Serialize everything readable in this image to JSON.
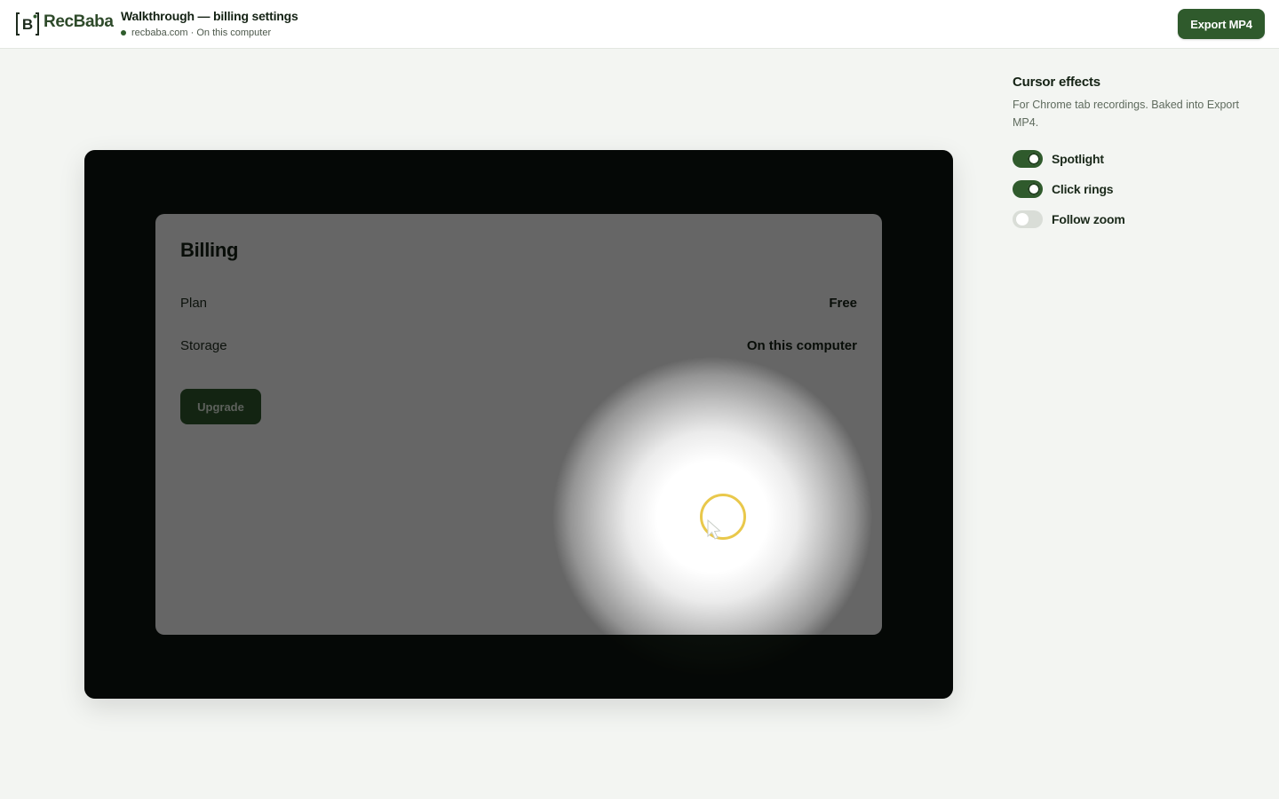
{
  "app": {
    "brand": "RecBaba",
    "document_title": "Walkthrough — billing settings",
    "document_subtitle": "recbaba.com · On this computer",
    "export_label": "Export MP4",
    "accent_color": "#2f5a2c"
  },
  "preview": {
    "page_title": "Billing",
    "rows": [
      {
        "label": "Plan",
        "value": "Free"
      },
      {
        "label": "Storage",
        "value": "On this computer"
      }
    ],
    "upgrade_label": "Upgrade",
    "click_ring_color": "#e9c84b",
    "icons": [
      "arrow-pointer-icon",
      "click-ring-icon"
    ]
  },
  "cursor_effects": {
    "title": "Cursor effects",
    "description": "For Chrome tab recordings. Baked into Export MP4.",
    "toggles": [
      {
        "label": "Spotlight",
        "on": true
      },
      {
        "label": "Click rings",
        "on": true
      },
      {
        "label": "Follow zoom",
        "on": false
      }
    ]
  }
}
